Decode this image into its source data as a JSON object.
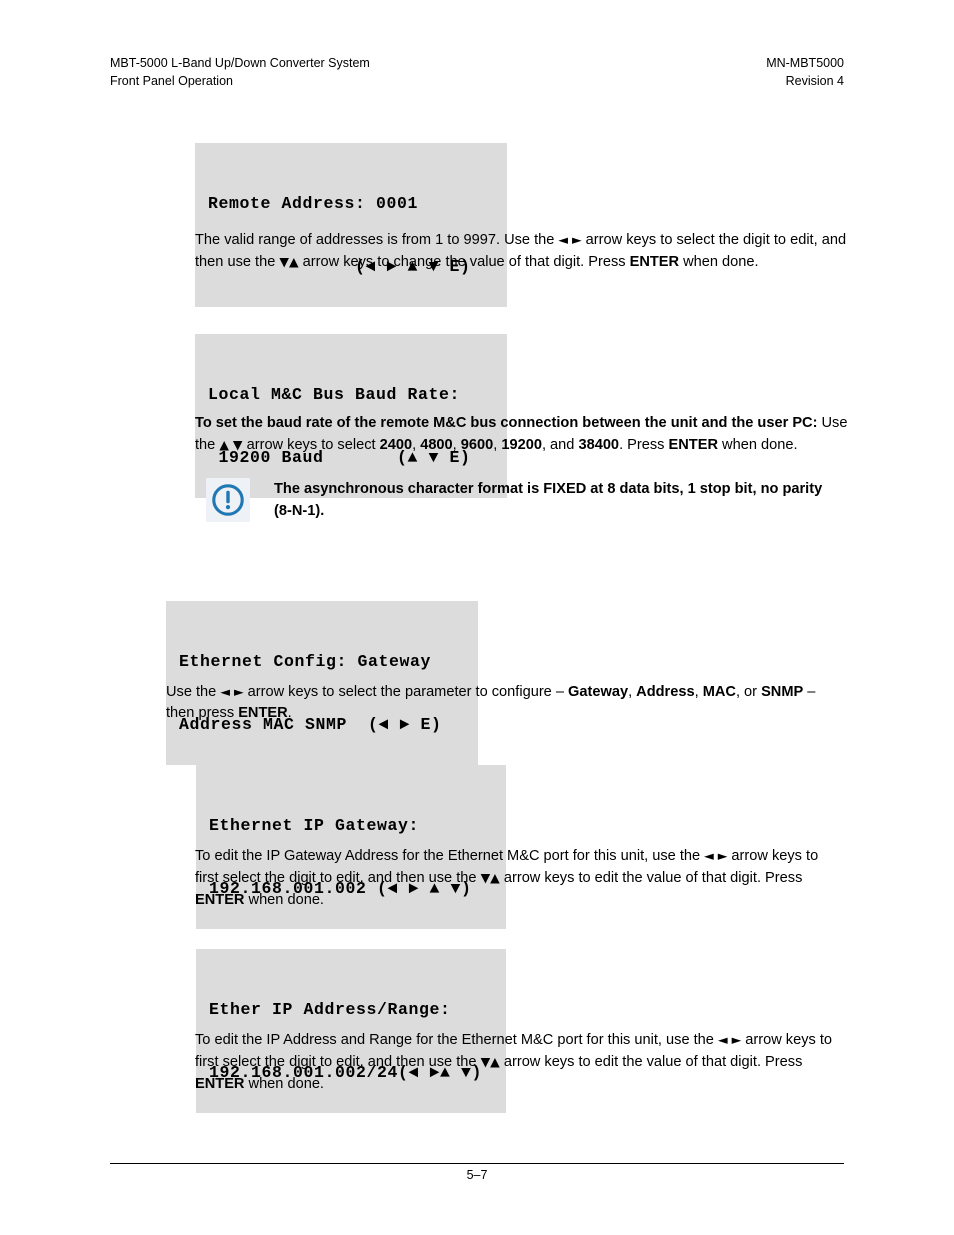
{
  "header": {
    "left_line1": "MBT-5000 L-Band Up/Down Converter System",
    "left_line2": "Front Panel Operation",
    "right_line1": "MN-MBT5000",
    "right_line2": "Revision 4"
  },
  "displays": {
    "remote_address": {
      "line1": "Remote Address: 0001",
      "line2": "              (◄ ► ▲ ▼ E)"
    },
    "baud_rate": {
      "line1": "Local M&C Bus Baud Rate:",
      "line2": " 19200 Baud       (▲ ▼ E)"
    },
    "ethernet_config": {
      "line1": "Ethernet Config: Gateway",
      "line2": "Address MAC SNMP  (◄ ► E)"
    },
    "ip_gateway": {
      "line1": "Ethernet IP Gateway:",
      "line2": "192.168.001.002 (◄ ► ▲ ▼)"
    },
    "ip_address_range": {
      "line1": "Ether IP Address/Range:",
      "line2": "192.168.001.002/24(◄ ►▲ ▼)"
    }
  },
  "paragraphs": {
    "remote_address": {
      "seg1": "The valid range of addresses is from 1 to 9997. Use the ",
      "arrows1": "◄ ►",
      "seg2": " arrow keys to select the digit to edit, and then use the ",
      "arrows2": "▼▲",
      "seg3": " arrow keys to change the value of that digit. Press ",
      "bold_enter": "ENTER",
      "seg4": " when done."
    },
    "baud_rate": {
      "bold_lead": "To set the baud rate of the remote M&C bus connection between the unit and the user PC:",
      "seg1": " Use the ",
      "arrows1": "▲ ▼",
      "seg2": " arrow keys to select ",
      "option1": "2400",
      "sep1": ", ",
      "option2": "4800",
      "sep2": ", ",
      "option3": "9600",
      "sep3": ", ",
      "option4": "19200",
      "sep4": ", and ",
      "option5": "38400",
      "seg3": ". Press ",
      "bold_enter": "ENTER",
      "seg4": " when done."
    },
    "ethernet_config": {
      "seg1": "Use the ",
      "arrows1": "◄ ►",
      "seg2": " arrow keys to select the parameter to configure – ",
      "option1": "Gateway",
      "sep1": ", ",
      "option2": "Address",
      "sep2": ", ",
      "option3": "MAC",
      "sep3": ", or ",
      "option4": "SNMP",
      "seg3": "  – then press ",
      "bold_enter": "ENTER",
      "seg4": "."
    },
    "ip_gateway": {
      "seg1": "To edit the IP Gateway Address for the Ethernet M&C port for this unit, use the ",
      "arrows1": "◄ ►",
      "seg2": " arrow keys to first select the digit to edit, and then use the ",
      "arrows2": "▼▲",
      "seg3": "  arrow keys to edit the value of that digit. Press ",
      "bold_enter": "ENTER",
      "seg4": " when done."
    },
    "ip_address_range": {
      "seg1": "To edit the IP Address and Range for the Ethernet M&C port for this unit, use the ",
      "arrows1": "◄ ►",
      "seg2": " arrow keys to first select the digit to edit, and then use the ",
      "arrows2": "▼▲",
      "seg3": "  arrow keys to edit the value of that digit. Press ",
      "bold_enter": "ENTER",
      "seg4": " when done."
    }
  },
  "note": {
    "icon": "exclamation-circle-icon",
    "text_line1": "The asynchronous character format is FIXED at 8 data bits, 1 stop bit, no parity",
    "text_line2": "(8-N-1).",
    "icon_color": "#1f78b4",
    "icon_background": "#eef1f6"
  },
  "footer": {
    "page_number": "5–7"
  },
  "colors": {
    "lcd_background": "#dcdcdc",
    "text": "#000000",
    "page_background": "#ffffff"
  }
}
